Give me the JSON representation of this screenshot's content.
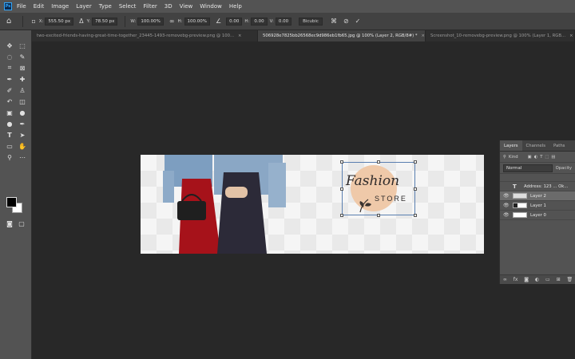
{
  "menu": [
    "File",
    "Edit",
    "Image",
    "Layer",
    "Type",
    "Select",
    "Filter",
    "3D",
    "View",
    "Window",
    "Help"
  ],
  "options": {
    "x_label": "X:",
    "x_value": "555.50 px",
    "y_label": "Y:",
    "y_value": "78.50 px",
    "w_label": "W:",
    "w_value": "100.00%",
    "h_label": "H:",
    "h_value": "100.00%",
    "angle_value": "0.00",
    "hskew_label": "H:",
    "hskew_value": "0.00",
    "vskew_label": "V:",
    "vskew_value": "0.00",
    "interpolation": "Bicubic"
  },
  "tabs": [
    {
      "label": "two-excited-friends-having-great-time-together_23445-1493-removebg-preview.png @ 100...",
      "close": "×",
      "active": false
    },
    {
      "label": "506928e7825bb26568ec9d986eb1fb65.jpg @ 100% (Layer 2, RGB/8#) *",
      "close": "×",
      "active": true
    },
    {
      "label": "Screenshot_10-removebg-preview.png @ 100% (Layer 1, RGB...",
      "close": "×",
      "active": false
    }
  ],
  "canvas": {
    "logo_script": "Fashion",
    "logo_store": "STORE",
    "logo_circle_color": "#efc9a9"
  },
  "layers_panel": {
    "tabs": [
      "Layers",
      "Channels",
      "Paths"
    ],
    "filter_label": "Kind",
    "blend_mode": "Normal",
    "opacity_label": "Opacity",
    "layers": [
      {
        "name": "Address: 123 ... Ok...",
        "type": "text",
        "visible": false,
        "selected": false
      },
      {
        "name": "Layer 2",
        "type": "image",
        "visible": true,
        "selected": true
      },
      {
        "name": "Layer 1",
        "type": "image",
        "visible": true,
        "selected": false
      },
      {
        "name": "Layer 0",
        "type": "image",
        "visible": true,
        "selected": false
      }
    ]
  },
  "colors": {
    "foreground": "#000000",
    "background": "#ffffff",
    "accent": "#31a8ff"
  }
}
